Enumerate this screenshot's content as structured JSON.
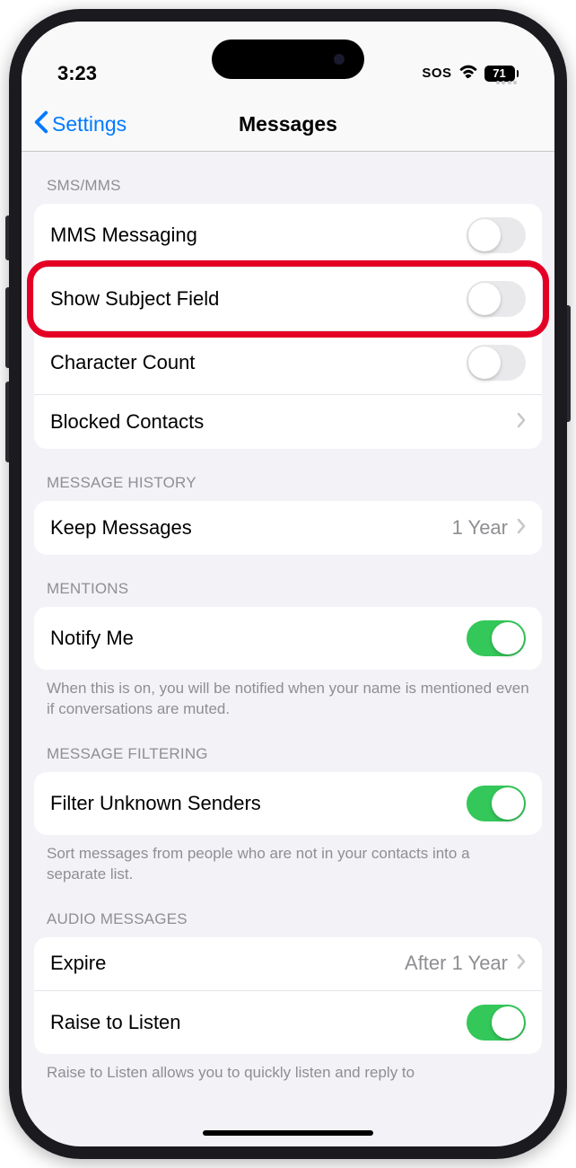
{
  "status_bar": {
    "time": "3:23",
    "sos": "SOS",
    "battery_level": "71"
  },
  "nav": {
    "back_label": "Settings",
    "title": "Messages"
  },
  "sections": {
    "sms_mms": {
      "header": "SMS/MMS",
      "mms_messaging": "MMS Messaging",
      "show_subject_field": "Show Subject Field",
      "character_count": "Character Count",
      "blocked_contacts": "Blocked Contacts"
    },
    "message_history": {
      "header": "MESSAGE HISTORY",
      "keep_messages": "Keep Messages",
      "keep_messages_value": "1 Year"
    },
    "mentions": {
      "header": "MENTIONS",
      "notify_me": "Notify Me",
      "footer": "When this is on, you will be notified when your name is mentioned even if conversations are muted."
    },
    "message_filtering": {
      "header": "MESSAGE FILTERING",
      "filter_unknown": "Filter Unknown Senders",
      "footer": "Sort messages from people who are not in your contacts into a separate list."
    },
    "audio_messages": {
      "header": "AUDIO MESSAGES",
      "expire": "Expire",
      "expire_value": "After 1 Year",
      "raise_to_listen": "Raise to Listen",
      "footer": "Raise to Listen allows you to quickly listen and reply to"
    }
  }
}
